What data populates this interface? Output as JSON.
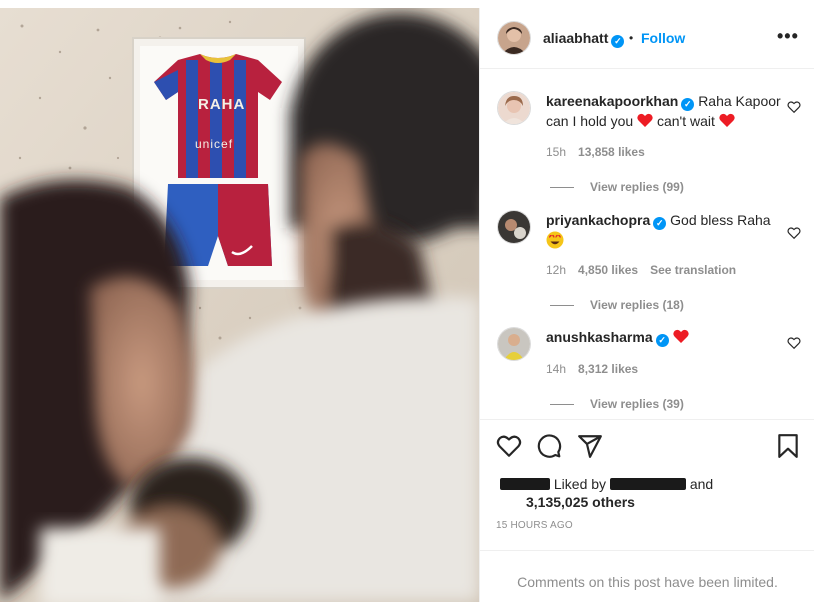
{
  "post": {
    "author": "aliaabhatt",
    "follow_label": "Follow",
    "separator": "•",
    "more_icon": "more-horizontal-icon"
  },
  "photo": {
    "jersey_name": "RAHA",
    "jersey_sponsor": "unicef"
  },
  "comments": [
    {
      "username": "kareenakapoorkhan",
      "text_a": "Raha Kapoor can I hold you ",
      "text_b": " can't wait ",
      "time": "15h",
      "likes": "13,858 likes",
      "replies": "View replies (99)"
    },
    {
      "username": "priyankachopra",
      "text_a": "God bless Raha",
      "time": "12h",
      "likes": "4,850 likes",
      "translate": "See translation",
      "replies": "View replies (18)"
    },
    {
      "username": "anushkasharma",
      "time": "14h",
      "likes": "8,312 likes",
      "replies": "View replies (39)"
    }
  ],
  "actions": {
    "like_icon": "heart-icon",
    "comment_icon": "comment-icon",
    "share_icon": "share-icon",
    "save_icon": "bookmark-icon"
  },
  "likes": {
    "liked_by_label": "Liked by",
    "and_label": "and",
    "others": "3,135,025 others"
  },
  "timestamp": "15 HOURS AGO",
  "limited_notice": "Comments on this post have been limited.",
  "colors": {
    "link_blue": "#0095f6",
    "muted_text": "#8e8e8e",
    "heart_red": "#ed1c24",
    "border": "#efefef"
  }
}
